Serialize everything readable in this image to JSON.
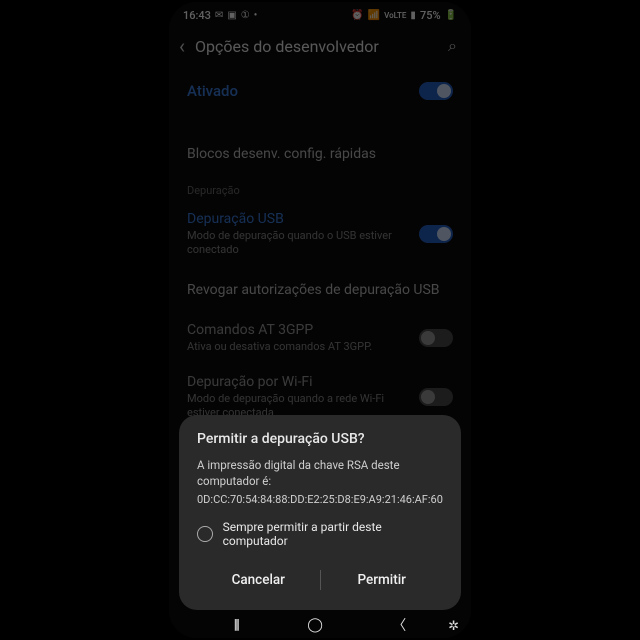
{
  "statusbar": {
    "time": "16:43",
    "battery": "75%"
  },
  "header": {
    "title": "Opções do desenvolvedor"
  },
  "activated": {
    "label": "Ativado"
  },
  "quick_tiles": {
    "label": "Blocos desenv. config. rápidas"
  },
  "section_debug": "Depuração",
  "usb_debug": {
    "title": "Depuração USB",
    "sub": "Modo de depuração quando o USB estiver conectado"
  },
  "revoke": {
    "title": "Revogar autorizações de depuração USB"
  },
  "at3gpp": {
    "title": "Comandos AT 3GPP",
    "sub": "Ativa ou desativa comandos AT 3GPP."
  },
  "wifi_debug": {
    "title": "Depuração por Wi-Fi",
    "sub": "Modo de depuração quando a rede Wi-Fi estiver conectada"
  },
  "dialog": {
    "title": "Permitir a depuração USB?",
    "body": "A impressão digital da chave RSA deste computador é:",
    "fingerprint": "0D:CC:70:54:84:88:DD:E2:25:D8:E9:A9:21:46:AF:60",
    "always": "Sempre permitir a partir deste computador",
    "cancel": "Cancelar",
    "allow": "Permitir"
  }
}
